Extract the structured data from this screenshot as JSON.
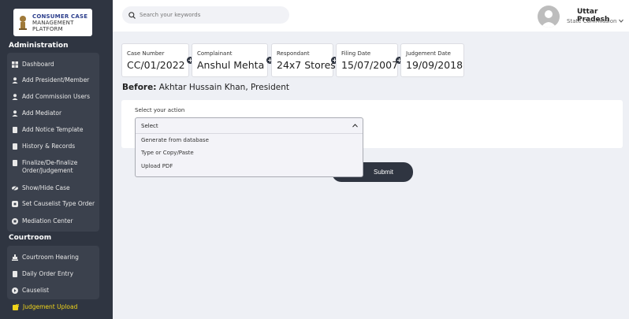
{
  "logo": {
    "line1": "CONSUMER CASE",
    "line2": "MANAGEMENT",
    "line3": "PLATFORM"
  },
  "sidebar": {
    "admin_title": "Administration",
    "admin_items": [
      {
        "label": "Dashboard",
        "icon": "grid-icon"
      },
      {
        "label": "Add President/Member",
        "icon": "user-icon"
      },
      {
        "label": "Add Commission Users",
        "icon": "user-icon"
      },
      {
        "label": "Add Mediator",
        "icon": "user-icon"
      },
      {
        "label": "Add Notice Template",
        "icon": "document-icon"
      },
      {
        "label": "History & Records",
        "icon": "document-icon"
      },
      {
        "label": "Finalize/De-finalize Order/Judgement",
        "icon": "document-icon"
      },
      {
        "label": "Show/Hide Case",
        "icon": "eye-slash-icon"
      },
      {
        "label": "Set Causelist Type Order",
        "icon": "settings-icon"
      },
      {
        "label": "Mediation Center",
        "icon": "building-icon"
      }
    ],
    "courtroom_title": "Courtroom",
    "courtroom_items": [
      {
        "label": "Courtroom Hearing",
        "icon": "gavel-icon"
      },
      {
        "label": "Daily Order Entry",
        "icon": "document-icon"
      },
      {
        "label": "Causelist",
        "icon": "list-icon"
      },
      {
        "label": "Judgement Upload",
        "icon": "upload-icon",
        "active": true
      }
    ]
  },
  "header": {
    "search_placeholder": "Search your keywords",
    "state": "Uttar Pradesh",
    "role": "State Commission"
  },
  "case": {
    "number_label": "Case Number",
    "number": "CC/01/2022",
    "complainant_label": "Complainant",
    "complainant": "Anshul Mehta",
    "respondant_label": "Respondant",
    "respondant": "24x7 Stores",
    "filing_label": "Filing Date",
    "filing": "15/07/2007",
    "judgement_label": "Judgement Date",
    "judgement": "19/09/2018"
  },
  "before": {
    "prefix": "Before:",
    "name": "Akhtar Hussain Khan, President"
  },
  "action": {
    "label": "Select your action",
    "selected": "Select",
    "options": [
      "Generate from database",
      "Type or Copy/Paste",
      "Upload PDF"
    ]
  },
  "submit_label": "Submit",
  "colors": {
    "sidebar": "#2f3541",
    "active": "#f0d41a",
    "background": "#eef0f5"
  }
}
